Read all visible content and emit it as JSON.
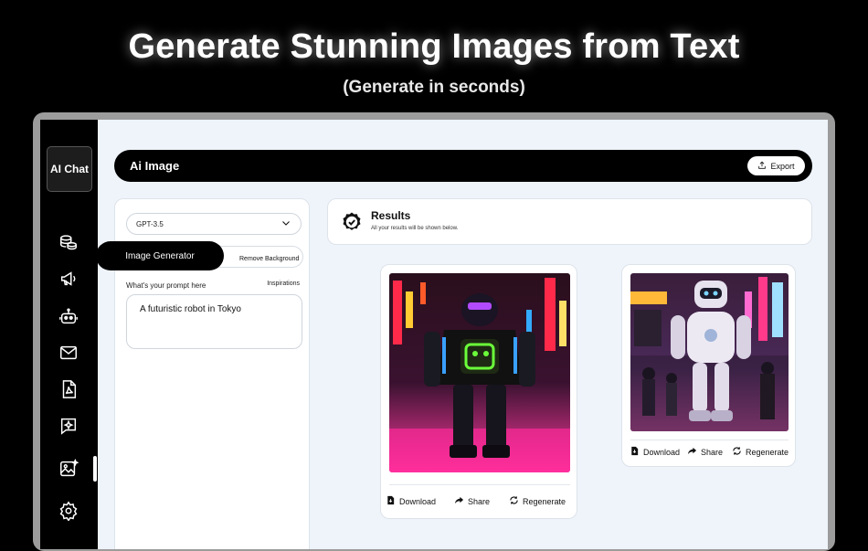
{
  "hero": {
    "title": "Generate Stunning Images from Text",
    "subtitle": "(Generate in seconds)"
  },
  "sidebar": {
    "brand": "AI Chat",
    "icons": [
      "coins-icon",
      "megaphone-icon",
      "robot-icon",
      "mail-icon",
      "pdf-file-icon",
      "sparkle-chat-icon",
      "image-ai-icon",
      "settings-icon"
    ],
    "active_index": 6
  },
  "header": {
    "title": "Ai Image",
    "export_label": "Export"
  },
  "controls": {
    "model": "GPT-3.5",
    "tabs": [
      "Image Generator",
      "Remove Background"
    ],
    "active_tab": "Image Generator",
    "prompt_label": "What's your prompt here",
    "inspirations_label": "Inspirations",
    "prompt_value": "A futuristic robot in Tokyo"
  },
  "results": {
    "title": "Results",
    "subtitle": "All your results will be shown below."
  },
  "cards": [
    {
      "download": "Download",
      "share": "Share",
      "regenerate": "Regenerate"
    },
    {
      "download": "Download",
      "share": "Share",
      "regenerate": "Regenerate"
    }
  ],
  "colors": {
    "accent": "#000000",
    "panel_bg": "#eef4fa",
    "neon_pink": "#ff2d8a",
    "neon_green": "#6bff3a"
  }
}
